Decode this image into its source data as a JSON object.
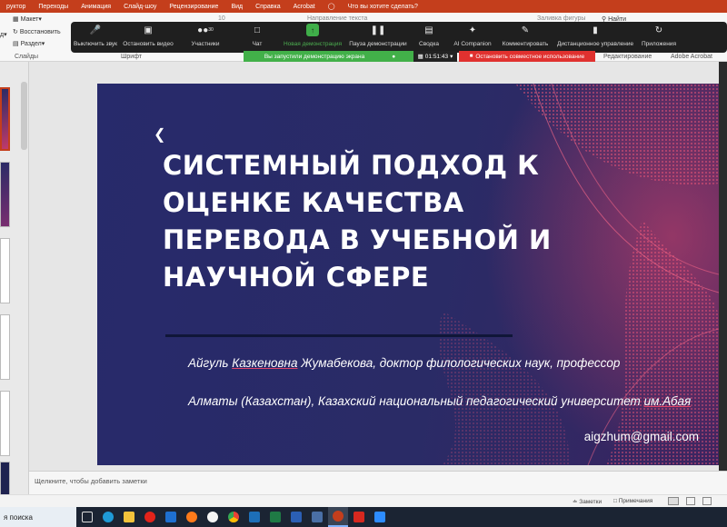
{
  "menubar": {
    "items": [
      "руктор",
      "Переходы",
      "Анимация",
      "Слайд-шоу",
      "Рецензирование",
      "Вид",
      "Справка",
      "Acrobat"
    ],
    "search_hint": "Что вы хотите сделать?"
  },
  "ribbon": {
    "maket": "Макет",
    "restore": "Восстановить",
    "section": "Раздел",
    "group_slides": "Слайды",
    "group_font": "Шрифт",
    "direction_text": "Направление текста",
    "find": "Найти",
    "shape_fill": "Заливка фигуры",
    "group_editing": "Редактирование",
    "group_acrobat": "Adobe Acrobat",
    "font_size_fragment": "10"
  },
  "zoom_toolbar": {
    "buttons": [
      {
        "label": "Выключить звук",
        "icon": "microphone-icon"
      },
      {
        "label": "Остановить видео",
        "icon": "video-camera-icon"
      },
      {
        "label": "Участники",
        "icon": "participants-icon",
        "count": "30"
      },
      {
        "label": "Чат",
        "icon": "chat-icon"
      },
      {
        "label": "Новая демонстрация",
        "icon": "share-screen-icon"
      },
      {
        "label": "Пауза демонстрации",
        "icon": "pause-icon"
      },
      {
        "label": "Сводка",
        "icon": "summary-icon"
      },
      {
        "label": "AI Companion",
        "icon": "sparkle-icon"
      },
      {
        "label": "Комментировать",
        "icon": "annotate-icon"
      },
      {
        "label": "Дистанционное управление",
        "icon": "remote-control-icon"
      },
      {
        "label": "Приложения",
        "icon": "apps-icon"
      }
    ],
    "sharing_banner": "Вы запустили демонстрацию экрана",
    "timer": "01:51:43",
    "stop_sharing": "Остановить совместное использование"
  },
  "slide": {
    "title": "СИСТЕМНЫЙ ПОДХОД К ОЦЕНКЕ КАЧЕСТВА ПЕРЕВОДА В УЧЕБНОЙ И НАУЧНОЙ СФЕРЕ",
    "author_first": "Айгуль",
    "author_patronymic": "Казкеновна",
    "author_rest": "Жумабекова, доктор филологических наук, профессор",
    "affiliation_main": "Алматы (Казахстан), Казахский национальный педагогический университет",
    "affiliation_tail": "им.Абая",
    "email": "aigzhum@gmail.com"
  },
  "notes_placeholder": "Щелкните, чтобы добавить заметки",
  "statusbar": {
    "notes": "Заметки",
    "comments": "Примечания"
  },
  "taskbar": {
    "search": "я поиска"
  },
  "colors": {
    "slide_bg": "#272a6b",
    "wave_pink": "#e0456a",
    "zoom_green": "#42b049",
    "zoom_red": "#e0312f",
    "ppt_orange": "#c43e1c"
  }
}
